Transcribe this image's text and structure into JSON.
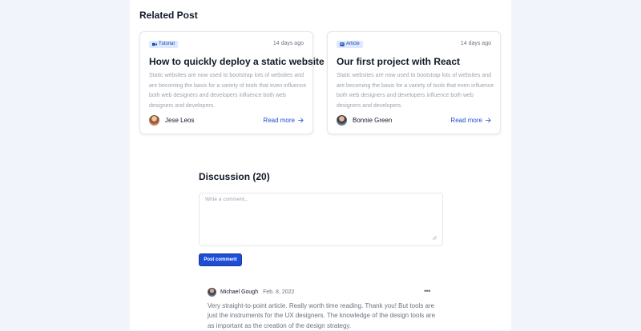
{
  "related": {
    "title": "Related Post",
    "posts": [
      {
        "badge": "Tutorial",
        "badge_icon": "video-icon",
        "date": "14 days ago",
        "title": "How to quickly deploy a static website",
        "description": "Static websites are now used to bootstrap lots of websites and are becoming the basis for a variety of tools that even influence both web designers and developers influence both web designers and developers.",
        "author": "Jese Leos",
        "read_more": "Read more"
      },
      {
        "badge": "Article",
        "badge_icon": "article-icon",
        "date": "14 days ago",
        "title": "Our first project with React",
        "description": "Static websites are now used to bootstrap lots of websites and are becoming the basis for a variety of tools that even influence both web designers and developers influence both web designers and developers.",
        "author": "Bonnie Green",
        "read_more": "Read more"
      }
    ]
  },
  "discussion": {
    "title": "Discussion (20)",
    "placeholder": "Write a comment...",
    "post_button": "Post comment",
    "comments": [
      {
        "author": "Michael Gough",
        "date": "Feb. 8, 2022",
        "menu_icon": "more-horizontal-icon",
        "text": "Very straight-to-point article. Really worth time reading. Thank you! But tools are just the instruments for the UX designers. The knowledge of the design tools are as important as the creation of the design strategy."
      }
    ]
  },
  "colors": {
    "accent": "#1d4ed8",
    "badge_bg": "#dbeafe",
    "page_bg": "#f1f5fb"
  }
}
